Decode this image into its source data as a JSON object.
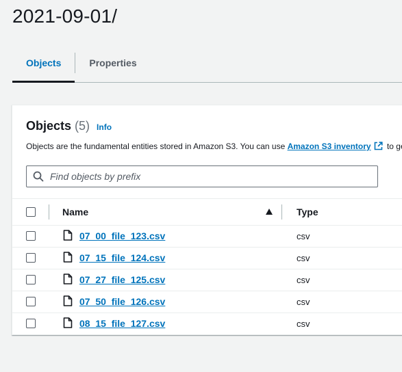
{
  "page": {
    "title": "2021-09-01/"
  },
  "tabs": [
    {
      "label": "Objects",
      "active": true
    },
    {
      "label": "Properties",
      "active": false
    }
  ],
  "panel": {
    "title": "Objects",
    "count": "(5)",
    "info": "Info",
    "description_prefix": "Objects are the fundamental entities stored in Amazon S3. You can use ",
    "description_link": "Amazon S3 inventory",
    "description_suffix": " to ge",
    "search_placeholder": "Find objects by prefix"
  },
  "table": {
    "columns": {
      "name": "Name",
      "type": "Type"
    },
    "sort": "ascending",
    "rows": [
      {
        "name": "07_00_file_123.csv",
        "type": "csv"
      },
      {
        "name": "07_15_file_124.csv",
        "type": "csv"
      },
      {
        "name": "07_27_file_125.csv",
        "type": "csv"
      },
      {
        "name": "07_50_file_126.csv",
        "type": "csv"
      },
      {
        "name": "08_15_file_127.csv",
        "type": "csv"
      }
    ]
  },
  "colors": {
    "accent": "#0073bb",
    "text": "#16191f",
    "background": "#f2f3f3"
  }
}
